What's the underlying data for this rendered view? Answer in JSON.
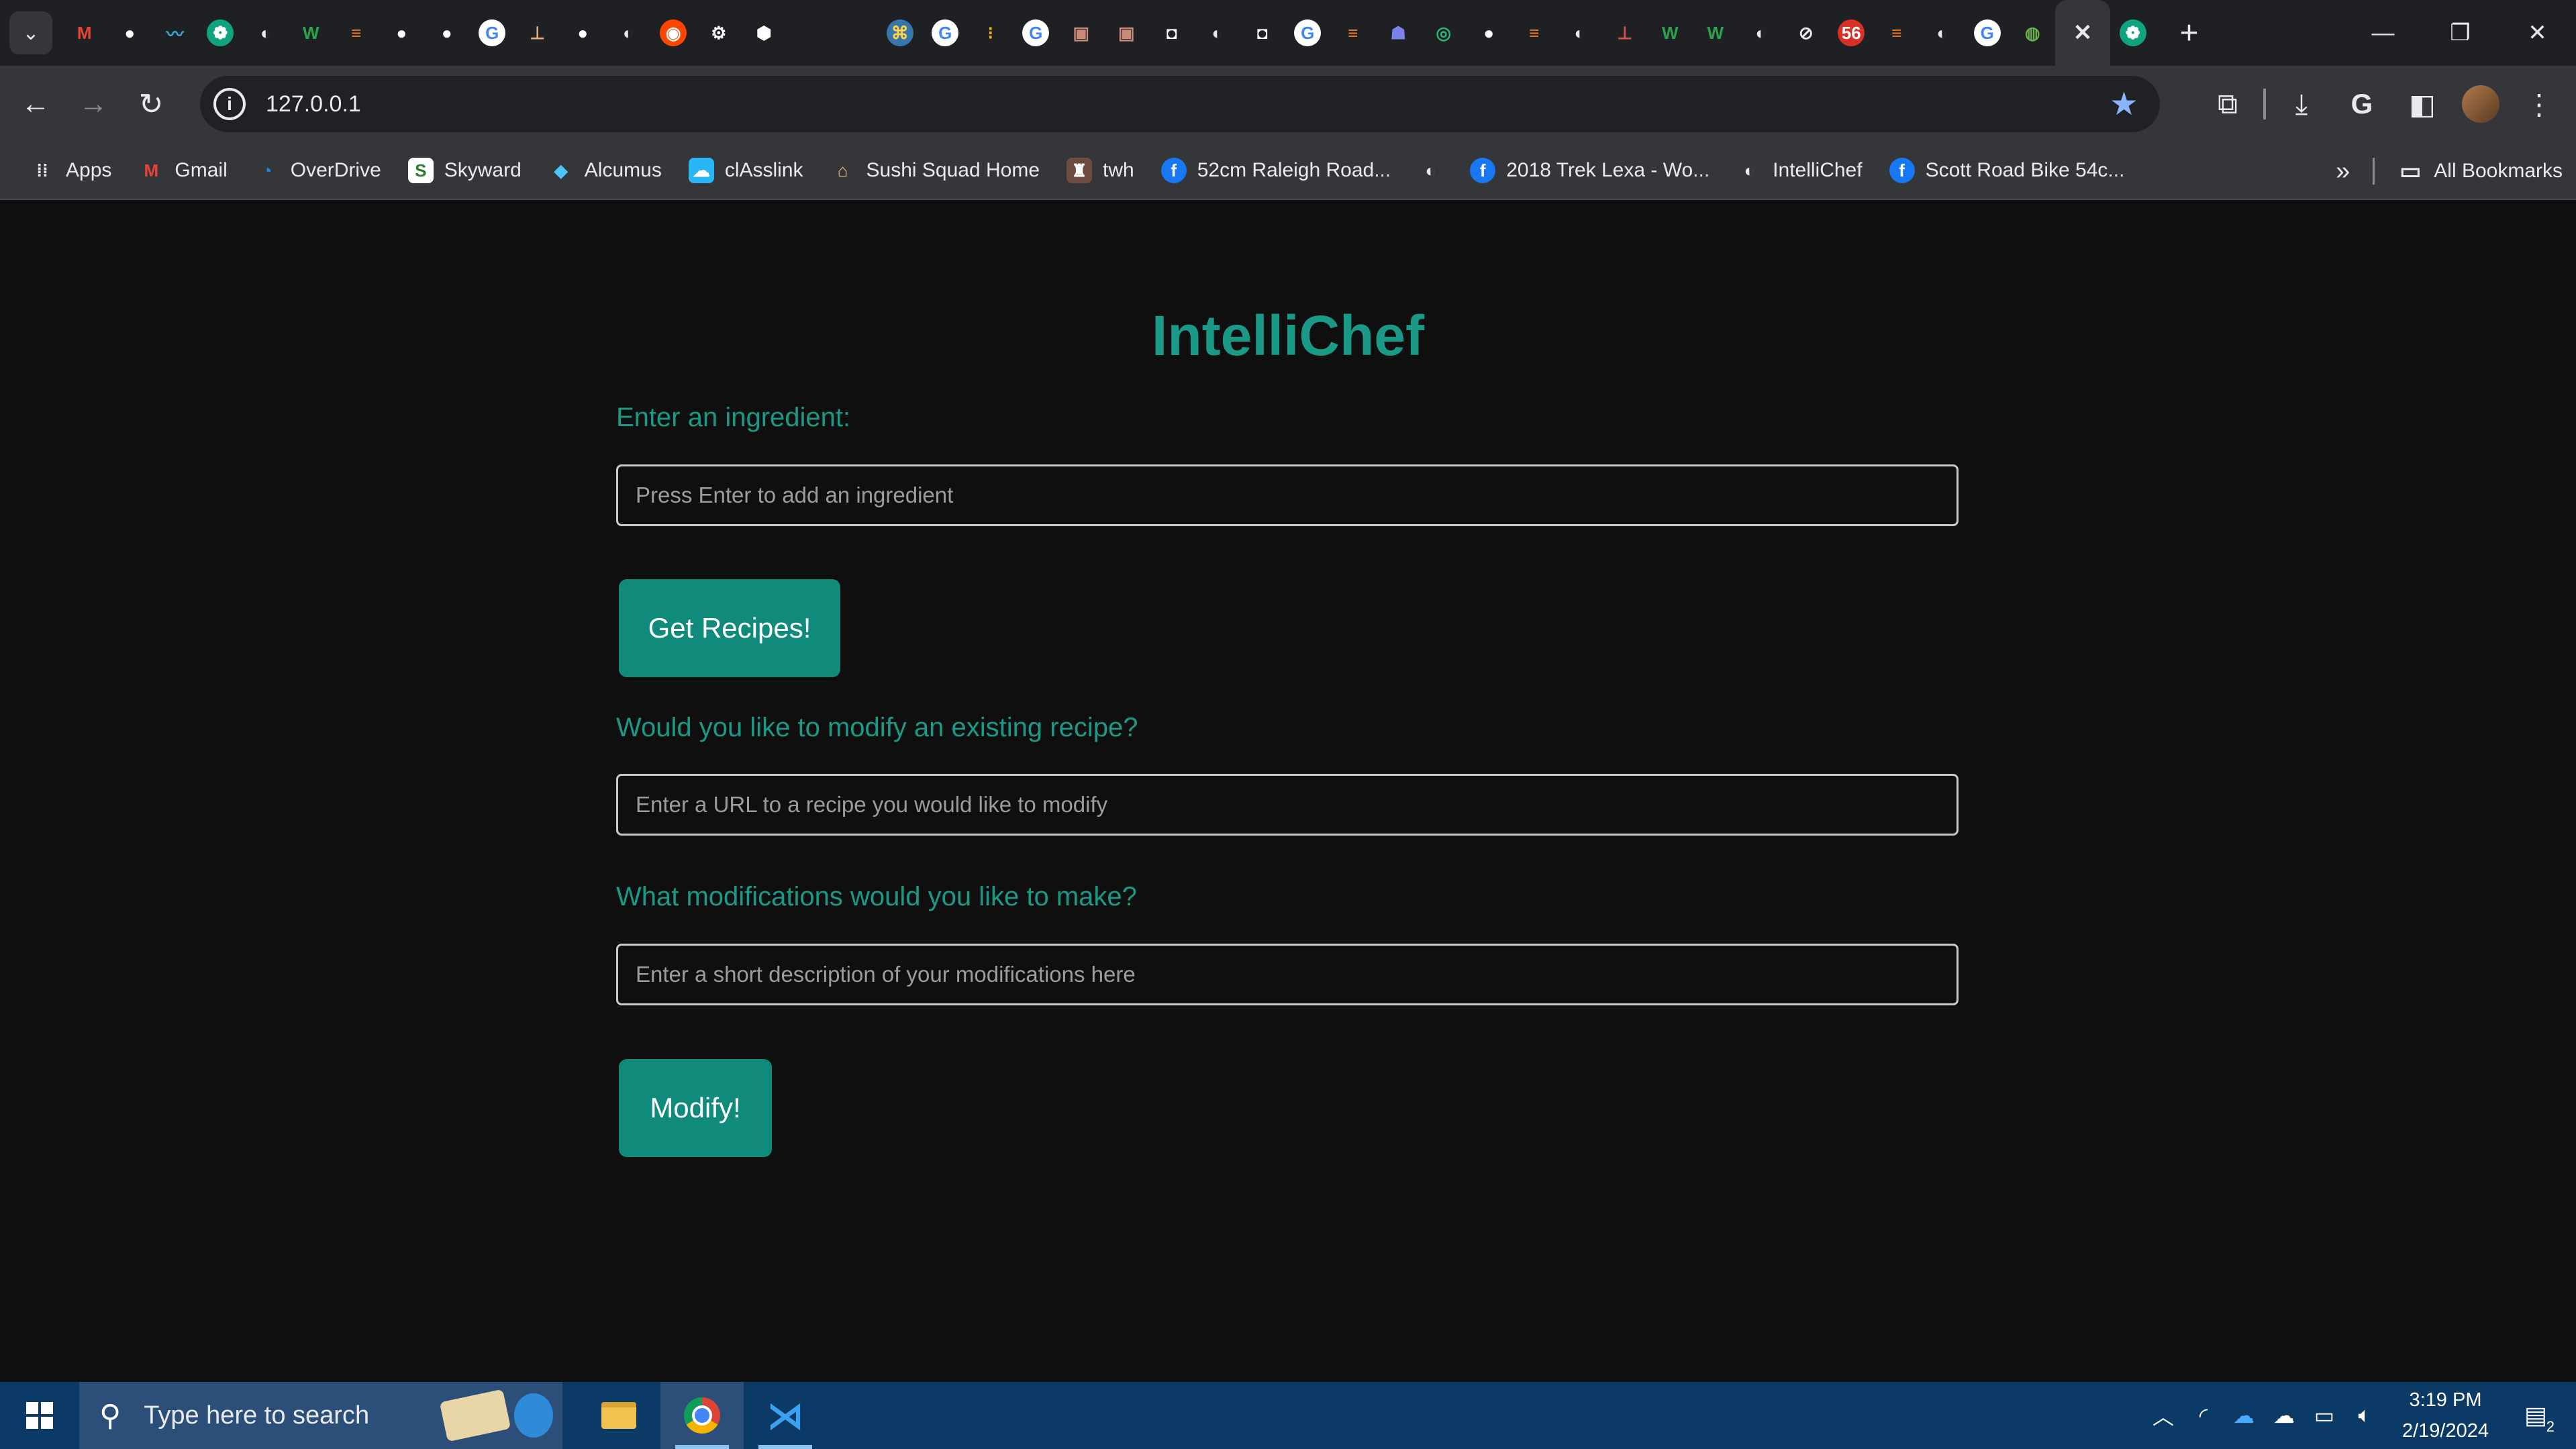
{
  "browser": {
    "tabs": [
      {
        "icon": "gmail-icon",
        "glyph": "M",
        "color": "#ea4335",
        "bg": "transparent"
      },
      {
        "icon": "github-icon",
        "glyph": "●",
        "color": "#ffffff",
        "bg": "transparent"
      },
      {
        "icon": "wave-icon",
        "glyph": "〰",
        "color": "#38a8e0",
        "bg": "transparent"
      },
      {
        "icon": "chatgpt-icon",
        "glyph": "❁",
        "color": "#ffffff",
        "bg": "#10a37f"
      },
      {
        "icon": "globe-icon",
        "glyph": "◐",
        "color": "#e8eaed",
        "bg": "transparent"
      },
      {
        "icon": "wolfram-icon",
        "glyph": "W",
        "color": "#2ba24c",
        "bg": "transparent"
      },
      {
        "icon": "stackoverflow-icon",
        "glyph": "≡",
        "color": "#f48024",
        "bg": "transparent"
      },
      {
        "icon": "github-icon",
        "glyph": "●",
        "color": "#ffffff",
        "bg": "transparent"
      },
      {
        "icon": "github-icon",
        "glyph": "●",
        "color": "#ffffff",
        "bg": "transparent"
      },
      {
        "icon": "google-icon",
        "glyph": "G",
        "color": "#4285f4",
        "bg": "#ffffff"
      },
      {
        "icon": "anvil-icon",
        "glyph": "⊥",
        "color": "#e0b080",
        "bg": "transparent"
      },
      {
        "icon": "github-icon",
        "glyph": "●",
        "color": "#ffffff",
        "bg": "transparent"
      },
      {
        "icon": "globe-icon",
        "glyph": "◐",
        "color": "#e8eaed",
        "bg": "transparent"
      },
      {
        "icon": "reddit-icon",
        "glyph": "◉",
        "color": "#ffffff",
        "bg": "#ff4500"
      },
      {
        "icon": "gear-icon",
        "glyph": "⚙",
        "color": "#ffffff",
        "bg": "transparent"
      },
      {
        "icon": "cube-icon",
        "glyph": "⬢",
        "color": "#ffffff",
        "bg": "transparent"
      },
      {
        "icon": "blank-icon",
        "glyph": "",
        "color": "#ffffff",
        "bg": "transparent"
      },
      {
        "icon": "blank-icon",
        "glyph": "",
        "color": "#ffffff",
        "bg": "transparent"
      },
      {
        "icon": "python-icon",
        "glyph": "⌘",
        "color": "#ffd343",
        "bg": "#3776ab"
      },
      {
        "icon": "google-icon",
        "glyph": "G",
        "color": "#4285f4",
        "bg": "#ffffff"
      },
      {
        "icon": "grid-icon",
        "glyph": "⁝",
        "color": "#f4b400",
        "bg": "transparent"
      },
      {
        "icon": "google-icon",
        "glyph": "G",
        "color": "#4285f4",
        "bg": "#ffffff"
      },
      {
        "icon": "photo-icon",
        "glyph": "▣",
        "color": "#c98a7a",
        "bg": "transparent"
      },
      {
        "icon": "photo-icon",
        "glyph": "▣",
        "color": "#c98a7a",
        "bg": "transparent"
      },
      {
        "icon": "ghost-icon",
        "glyph": "◘",
        "color": "#ffffff",
        "bg": "transparent"
      },
      {
        "icon": "globe-icon",
        "glyph": "◐",
        "color": "#e8eaed",
        "bg": "transparent"
      },
      {
        "icon": "ghost-icon",
        "glyph": "◘",
        "color": "#ffffff",
        "bg": "transparent"
      },
      {
        "icon": "google-icon",
        "glyph": "G",
        "color": "#4285f4",
        "bg": "#ffffff"
      },
      {
        "icon": "stackoverflow-icon",
        "glyph": "≡",
        "color": "#f48024",
        "bg": "transparent"
      },
      {
        "icon": "teams-icon",
        "glyph": "☗",
        "color": "#7b83eb",
        "bg": "transparent"
      },
      {
        "icon": "eye-icon",
        "glyph": "◎",
        "color": "#2bb673",
        "bg": "transparent"
      },
      {
        "icon": "github-icon",
        "glyph": "●",
        "color": "#ffffff",
        "bg": "transparent"
      },
      {
        "icon": "stackoverflow-icon",
        "glyph": "≡",
        "color": "#f48024",
        "bg": "transparent"
      },
      {
        "icon": "globe-icon",
        "glyph": "◐",
        "color": "#e8eaed",
        "bg": "transparent"
      },
      {
        "icon": "anvil-icon",
        "glyph": "⊥",
        "color": "#d9534f",
        "bg": "transparent"
      },
      {
        "icon": "wolfram-icon",
        "glyph": "W",
        "color": "#2ba24c",
        "bg": "transparent"
      },
      {
        "icon": "wolfram-icon",
        "glyph": "W",
        "color": "#2ba24c",
        "bg": "transparent"
      },
      {
        "icon": "globe-icon",
        "glyph": "◐",
        "color": "#e8eaed",
        "bg": "transparent"
      },
      {
        "icon": "slash-icon",
        "glyph": "⊘",
        "color": "#e8eaed",
        "bg": "transparent"
      },
      {
        "icon": "badge-icon",
        "glyph": "56",
        "color": "#ffffff",
        "bg": "#d93025"
      },
      {
        "icon": "stackoverflow-icon",
        "glyph": "≡",
        "color": "#f48024",
        "bg": "transparent"
      },
      {
        "icon": "globe-icon",
        "glyph": "◐",
        "color": "#e8eaed",
        "bg": "transparent"
      },
      {
        "icon": "google-icon",
        "glyph": "G",
        "color": "#4285f4",
        "bg": "#ffffff"
      },
      {
        "icon": "circle-icon",
        "glyph": "◍",
        "color": "#6ab04c",
        "bg": "transparent"
      }
    ],
    "active_tab_close": "✕",
    "after_active_tab": {
      "icon": "chatgpt-icon",
      "glyph": "❁",
      "color": "#ffffff",
      "bg": "#10a37f"
    },
    "new_tab": "+",
    "window": {
      "minimize": "—",
      "restore": "❐",
      "close": "✕"
    },
    "url": "127.0.0.1",
    "bookmarks": [
      {
        "label": "Apps",
        "icon": "apps-grid-icon",
        "glyph": "⁞⁞",
        "color": "#e8eaed",
        "bg": "transparent"
      },
      {
        "label": "Gmail",
        "icon": "gmail-icon",
        "glyph": "M",
        "color": "#ea4335",
        "bg": "transparent"
      },
      {
        "label": "OverDrive",
        "icon": "overdrive-icon",
        "glyph": "◔",
        "color": "#1e88e5",
        "bg": "transparent"
      },
      {
        "label": "Skyward",
        "icon": "skyward-icon",
        "glyph": "S",
        "color": "#2e7d32",
        "bg": "#ffffff"
      },
      {
        "label": "Alcumus",
        "icon": "alcumus-icon",
        "glyph": "◆",
        "color": "#4fc3f7",
        "bg": "transparent"
      },
      {
        "label": "clAsslink",
        "icon": "classlink-icon",
        "glyph": "☁",
        "color": "#ffffff",
        "bg": "#29b6f6"
      },
      {
        "label": "Sushi Squad Home",
        "icon": "home-icon",
        "glyph": "⌂",
        "color": "#f6c177",
        "bg": "transparent"
      },
      {
        "label": "twh",
        "icon": "twh-icon",
        "glyph": "♜",
        "color": "#ffffff",
        "bg": "#6d4c41"
      },
      {
        "label": "52cm Raleigh Road...",
        "icon": "facebook-icon",
        "glyph": "f",
        "color": "#ffffff",
        "bg": "#1877f2"
      },
      {
        "label": "",
        "icon": "globe-icon",
        "glyph": "◐",
        "color": "#e8eaed",
        "bg": "transparent"
      },
      {
        "label": "2018 Trek Lexa - Wo...",
        "icon": "facebook-icon",
        "glyph": "f",
        "color": "#ffffff",
        "bg": "#1877f2"
      },
      {
        "label": "IntelliChef",
        "icon": "globe-icon",
        "glyph": "◐",
        "color": "#e8eaed",
        "bg": "transparent"
      },
      {
        "label": "Scott Road Bike 54c...",
        "icon": "facebook-icon",
        "glyph": "f",
        "color": "#ffffff",
        "bg": "#1877f2"
      }
    ],
    "bookmarks_overflow": "»",
    "all_bookmarks": "All Bookmarks"
  },
  "app": {
    "title": "IntelliChef",
    "ingredient_label": "Enter an ingredient:",
    "ingredient_placeholder": "Press Enter to add an ingredient",
    "get_recipes_button": "Get Recipes!",
    "modify_question": "Would you like to modify an existing recipe?",
    "url_placeholder": "Enter a URL to a recipe you would like to modify",
    "modifications_label": "What modifications would you like to make?",
    "modifications_placeholder": "Enter a short description of your modifications here",
    "modify_button": "Modify!"
  },
  "colors": {
    "accent_text": "#1a9a86",
    "button_bg": "#0f8a7b",
    "page_bg": "#0f0f10",
    "taskbar_bg": "#0c3a66"
  },
  "taskbar": {
    "search_placeholder": "Type here to search",
    "time": "3:19 PM",
    "date": "2/19/2024",
    "notification_count": "2"
  }
}
